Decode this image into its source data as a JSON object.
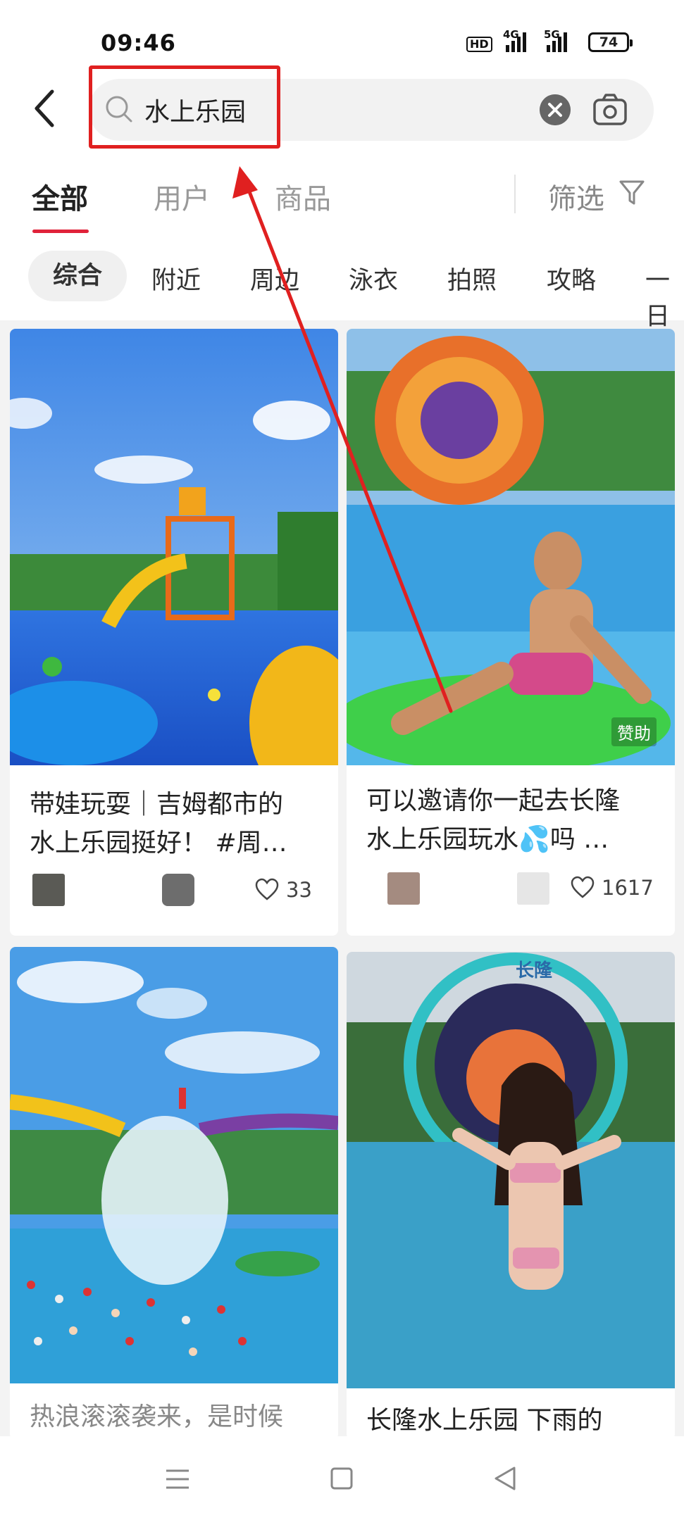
{
  "status_bar": {
    "time": "09:46",
    "hd_label": "HD",
    "network_1": "4G",
    "network_2": "5G",
    "battery": "74"
  },
  "search": {
    "query": "水上乐园"
  },
  "tabs": {
    "items": [
      "全部",
      "用户",
      "商品"
    ],
    "filter_label": "筛选"
  },
  "chips": [
    "综合",
    "附近",
    "周边",
    "泳衣",
    "拍照",
    "攻略",
    "一日"
  ],
  "feed": {
    "cards": [
      {
        "title_line1": "带娃玩耍｜吉姆都市的",
        "title_line2": "水上乐园挺好！ #周…",
        "likes": "33"
      },
      {
        "title_line1": "可以邀请你一起去长隆",
        "title_line2": "水上乐园玩水💦吗 …",
        "likes": "1617",
        "sponsor": "赞助"
      },
      {
        "title_line1": "热浪滚滚袭来，是时候"
      },
      {
        "title_line1": "长隆水上乐园 下雨的",
        "image_sign": "长隆"
      }
    ]
  },
  "colors": {
    "accent": "#e0223a",
    "annotation": "#e02020"
  }
}
